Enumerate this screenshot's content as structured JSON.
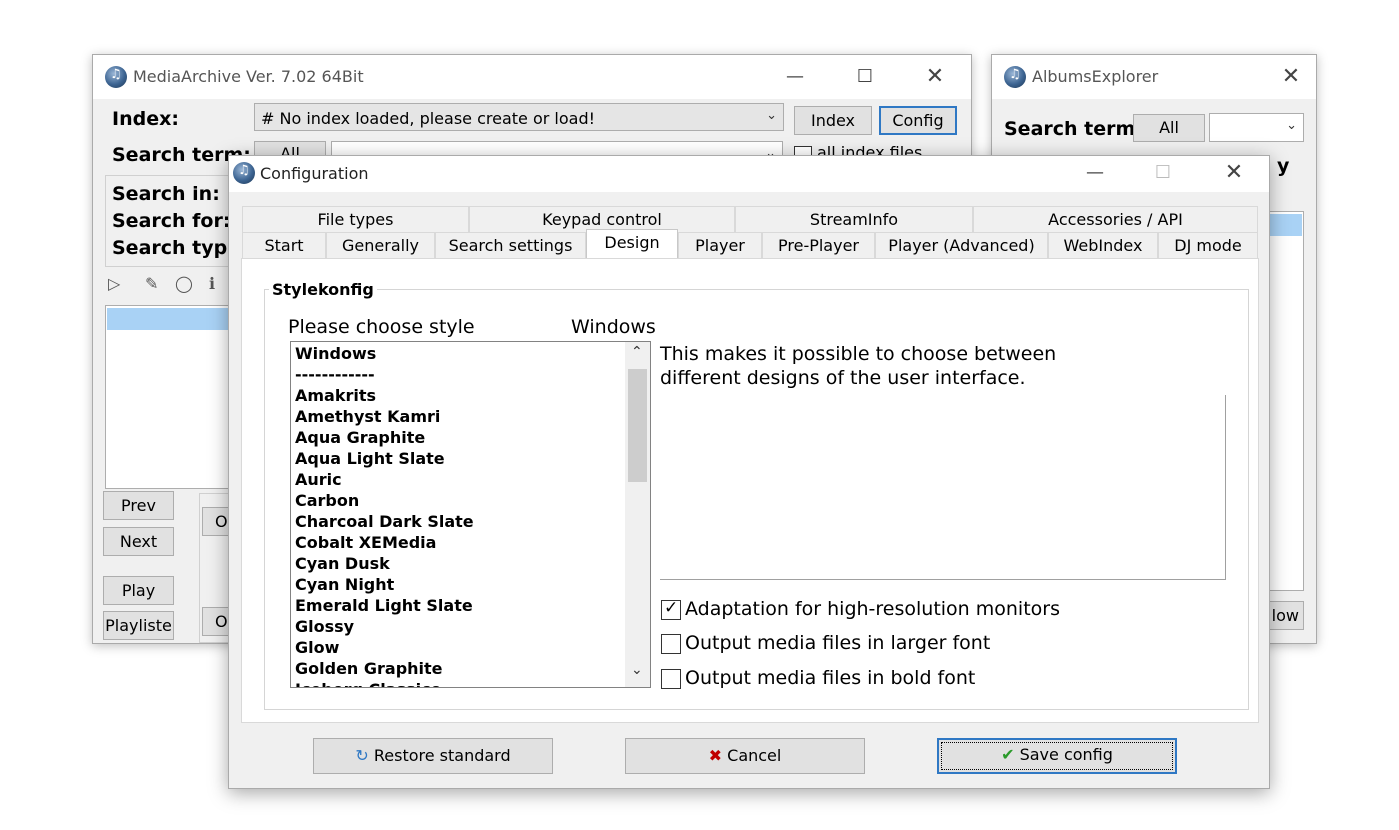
{
  "main_window": {
    "title": "MediaArchive Ver. 7.02 64Bit",
    "index_label": "Index:",
    "index_combo_value": "# No index loaded, please create or load!",
    "index_button": "Index",
    "config_button": "Config",
    "search_term_label": "Search term:",
    "all_button": "All",
    "all_index_files_label": "all index files",
    "search_in_label": "Search in:",
    "search_for_label": "Search for:",
    "search_type_label": "Search type:",
    "prev_button": "Prev",
    "next_button": "Next",
    "play_button": "Play",
    "playliste_button": "Playliste",
    "partial_button_1": "Or",
    "partial_button_2": "O"
  },
  "albums_window": {
    "title": "AlbumsExplorer",
    "search_term_label": "Search term:",
    "all_button": "All",
    "partial_label": "y",
    "partial_button": "low"
  },
  "config_dialog": {
    "title": "Configuration",
    "tabs_row1": [
      "File types",
      "Keypad control",
      "StreamInfo",
      "Accessories / API"
    ],
    "tabs_row2": [
      "Start",
      "Generally",
      "Search settings",
      "Design",
      "Player",
      "Pre-Player",
      "Player (Advanced)",
      "WebIndex",
      "DJ mode"
    ],
    "active_tab": "Design",
    "group_title": "Stylekonfig",
    "choose_style_label": "Please choose style",
    "current_style": "Windows",
    "styles": [
      "Windows",
      "------------",
      "Amakrits",
      "Amethyst Kamri",
      "Aqua Graphite",
      "Aqua Light Slate",
      "Auric",
      "Carbon",
      "Charcoal Dark Slate",
      "Cobalt XEMedia",
      "Cyan Dusk",
      "Cyan Night",
      "Emerald Light Slate",
      "Glossy",
      "Glow",
      "Golden Graphite",
      "Iceberg Classico"
    ],
    "description": "This makes it possible to choose between different designs of the user interface.",
    "options": [
      {
        "label": "Adaptation for high-resolution monitors",
        "checked": true
      },
      {
        "label": "Output media files in larger font",
        "checked": false
      },
      {
        "label": "Output media files in bold font",
        "checked": false
      }
    ],
    "restore_button": "Restore standard",
    "cancel_button": "Cancel",
    "save_button": "Save config"
  },
  "colors": {
    "selection_blue": "#a9d2f5",
    "cancel_red": "#c00000",
    "save_green": "#2a9a2a",
    "restore_blue": "#2f78c4"
  }
}
